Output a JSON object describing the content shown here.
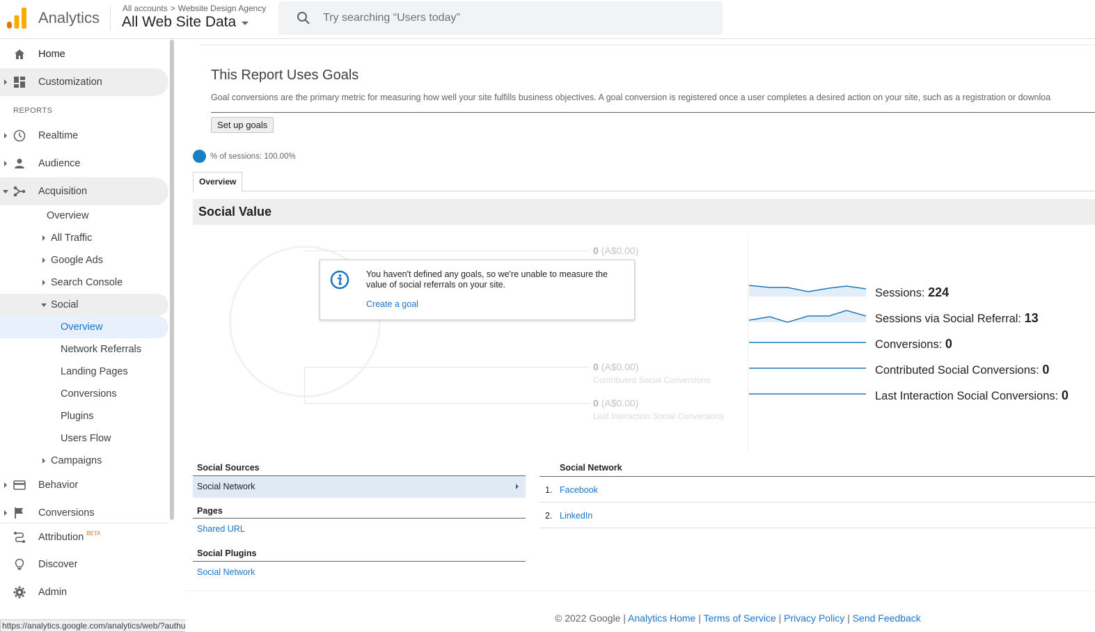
{
  "header": {
    "app_name": "Analytics",
    "breadcrumb": {
      "account": "All accounts",
      "separator": ">",
      "property": "Website Design Agency"
    },
    "view": "All Web Site Data",
    "search_placeholder": "Try searching “Users today”"
  },
  "sidebar": {
    "home": "Home",
    "customization": "Customization",
    "reports_header": "REPORTS",
    "realtime": "Realtime",
    "audience": "Audience",
    "acquisition": "Acquisition",
    "acq_overview": "Overview",
    "all_traffic": "All Traffic",
    "google_ads": "Google Ads",
    "search_console": "Search Console",
    "social": "Social",
    "social_items": [
      "Overview",
      "Network Referrals",
      "Landing Pages",
      "Conversions",
      "Plugins",
      "Users Flow"
    ],
    "campaigns": "Campaigns",
    "behavior": "Behavior",
    "conversions": "Conversions",
    "attribution": "Attribution",
    "attribution_badge": "BETA",
    "discover": "Discover",
    "admin": "Admin"
  },
  "status_url": "https://analytics.google.com/analytics/web/?authuser=2#/report/social-overview/a205591668w283772037p24",
  "main": {
    "goals_title": "This Report Uses Goals",
    "goals_desc": "Goal conversions are the primary metric for measuring how well your site fulfills business objectives. A goal conversion is registered once a user completes a desired action on your site, such as a registration or downloa",
    "setup_button": "Set up goals",
    "segment": "% of sessions: 100.00%",
    "tab": "Overview",
    "section_title": "Social Value",
    "faded": [
      {
        "value": "0",
        "currency": "(A$0.00)",
        "label": ""
      },
      {
        "value": "0",
        "currency": "(A$0.00)",
        "label": "Contributed Social Conversions"
      },
      {
        "value": "0",
        "currency": "(A$0.00)",
        "label": "Last Interaction Social Conversions"
      }
    ],
    "tooltip": {
      "text": "You haven't defined any goals, so we're unable to measure the value of social referrals on your site.",
      "link": "Create a goal"
    },
    "metrics": [
      {
        "label": "Sessions:",
        "value": "224"
      },
      {
        "label": "Sessions via Social Referral:",
        "value": "13"
      },
      {
        "label": "Conversions:",
        "value": "0"
      },
      {
        "label": "Contributed Social Conversions:",
        "value": "0"
      },
      {
        "label": "Last Interaction Social Conversions:",
        "value": "0"
      }
    ],
    "social_sources_title": "Social Sources",
    "social_sources_row": "Social Network",
    "pages_title": "Pages",
    "pages_link": "Shared URL",
    "plugins_title": "Social Plugins",
    "plugins_link": "Social Network",
    "network_title": "Social Network",
    "network_rows": [
      {
        "num": "1.",
        "name": "Facebook"
      },
      {
        "num": "2.",
        "name": "LinkedIn"
      }
    ]
  },
  "footer": {
    "copyright": "© 2022 Google",
    "sep": "|",
    "links": [
      "Analytics Home",
      "Terms of Service",
      "Privacy Policy",
      "Send Feedback"
    ]
  },
  "colors": {
    "accent": "#1a73c8",
    "segment": "#1a7fc2",
    "logo_orange": "#f9ab00",
    "logo_dark": "#e37400"
  }
}
